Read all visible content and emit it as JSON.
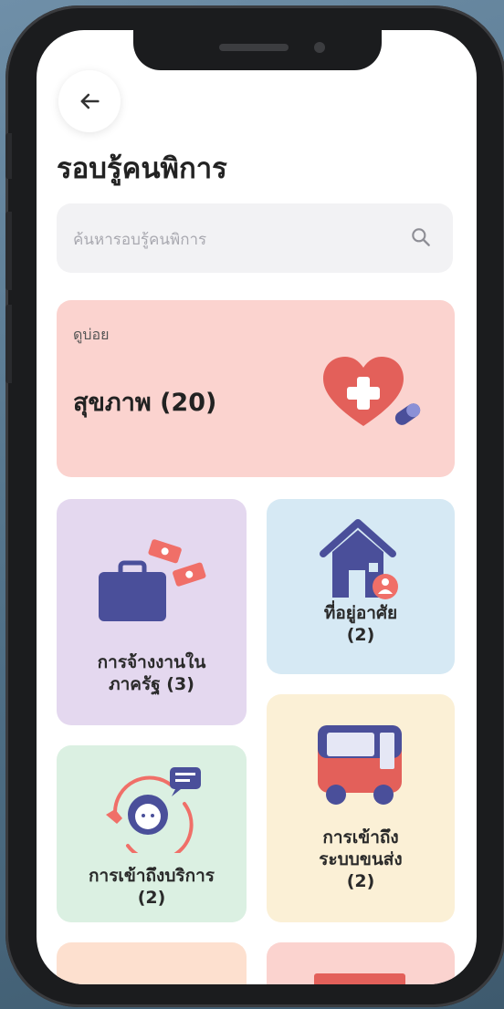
{
  "header": {
    "back_label": "",
    "title": "รอบรู้คนพิการ"
  },
  "search": {
    "placeholder": "ค้นหารอบรู้คนพิการ"
  },
  "frequent": {
    "caption": "ดูบ่อย",
    "title": "สุขภาพ (20)",
    "color": "#fbd3cf"
  },
  "categories": [
    {
      "id": "employment",
      "label_line1": "การจ้างงานใน",
      "label_line2": "ภาครัฐ (3)",
      "color": "#e4d8ef"
    },
    {
      "id": "housing",
      "label_line1": "ที่อยู่อาศัย",
      "label_line2": "(2)",
      "color": "#d6e9f4"
    },
    {
      "id": "services",
      "label_line1": "การเข้าถึงบริการ",
      "label_line2": "(2)",
      "color": "#dbf0e2"
    },
    {
      "id": "transport",
      "label_line1": "การเข้าถึง",
      "label_line2": "ระบบขนส่ง",
      "label_line3": "(2)",
      "color": "#fbf0d6"
    }
  ],
  "icons": [
    "back-arrow-icon",
    "search-icon",
    "heart-medical-icon",
    "briefcase-money-icon",
    "house-person-icon",
    "call-center-icon",
    "bus-icon"
  ]
}
